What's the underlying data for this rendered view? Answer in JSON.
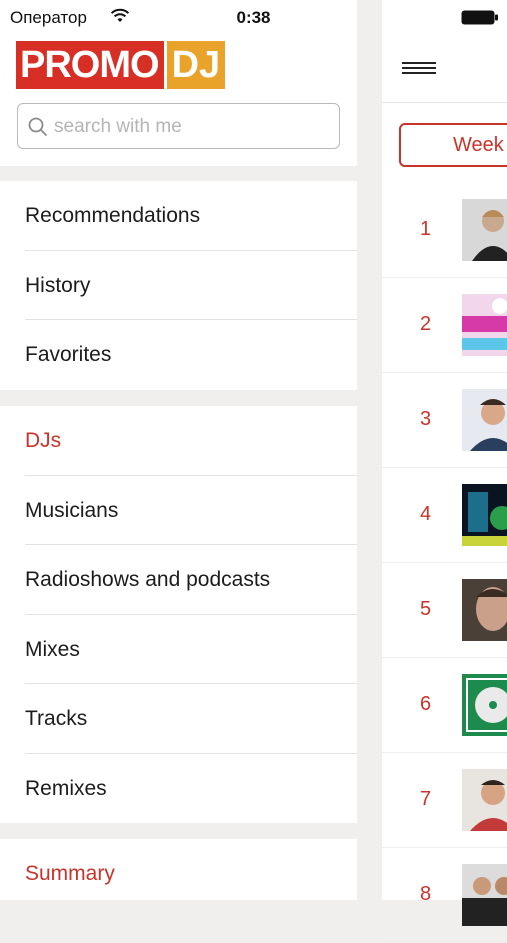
{
  "status": {
    "carrier": "Оператор",
    "time": "0:38"
  },
  "search": {
    "placeholder": "search with me"
  },
  "logo": {
    "part1": "PROMO",
    "part2": "DJ"
  },
  "menu": {
    "group1": [
      "Recommendations",
      "History",
      "Favorites"
    ],
    "group2": [
      "DJs",
      "Musicians",
      "Radioshows and podcasts",
      "Mixes",
      "Tracks",
      "Remixes"
    ],
    "group3": [
      "Summary"
    ]
  },
  "main": {
    "period_tab": "Week",
    "chart": [
      {
        "rank": "1"
      },
      {
        "rank": "2"
      },
      {
        "rank": "3"
      },
      {
        "rank": "4"
      },
      {
        "rank": "5"
      },
      {
        "rank": "6"
      },
      {
        "rank": "7"
      },
      {
        "rank": "8"
      }
    ]
  },
  "colors": {
    "accent": "#c8342a",
    "logo_red": "#d72e25",
    "logo_orange": "#e9a32b"
  }
}
